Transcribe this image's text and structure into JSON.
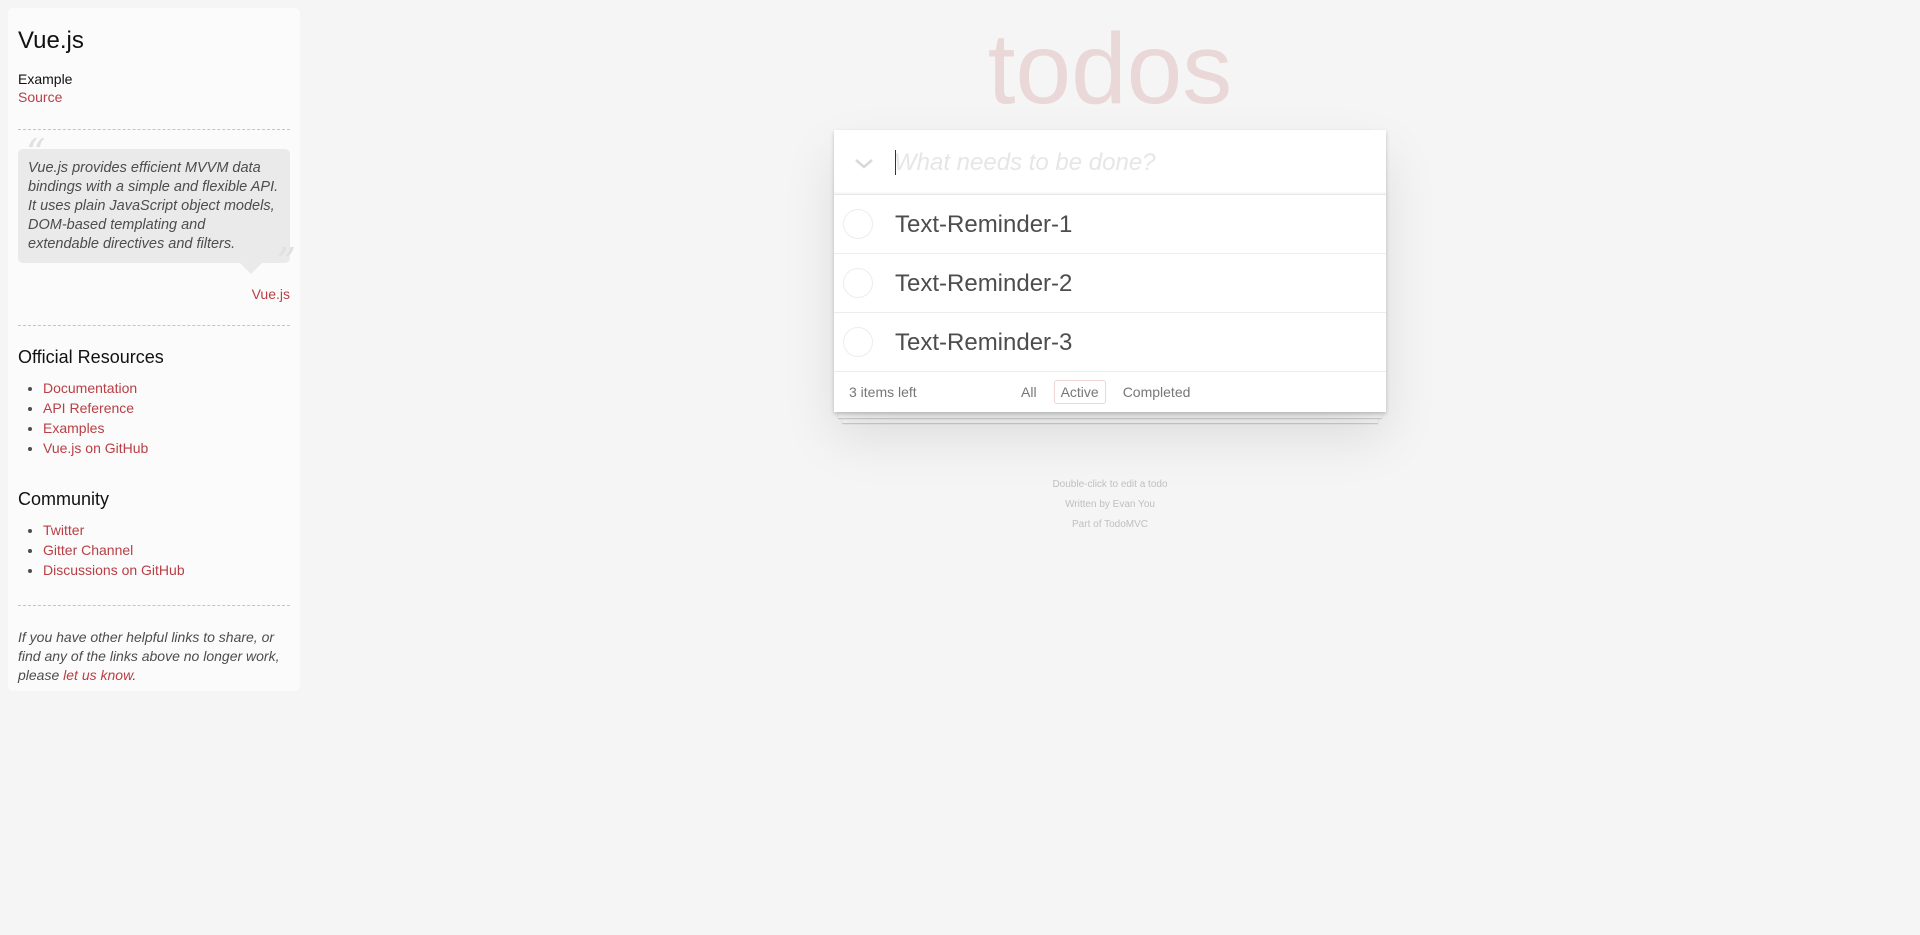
{
  "sidebar": {
    "title": "Vue.js",
    "example_label": "Example",
    "source_link": "Source",
    "quote": {
      "text": "Vue.js provides efficient MVVM data bindings with a simple and flexible API. It uses plain JavaScript object models, DOM-based templating and extendable directives and filters.",
      "footer": "Vue.js"
    },
    "official_resources": {
      "title": "Official Resources",
      "links": [
        "Documentation",
        "API Reference",
        "Examples",
        "Vue.js on GitHub"
      ]
    },
    "community": {
      "title": "Community",
      "links": [
        "Twitter",
        "Gitter Channel",
        "Discussions on GitHub"
      ]
    },
    "note": {
      "prefix": "If you have other helpful links to share, or find any of the links above no longer work, please ",
      "link": "let us know",
      "suffix": "."
    }
  },
  "app": {
    "title": "todos",
    "new_todo_placeholder": "What needs to be done?",
    "new_todo_value": "",
    "toggle_all_icon": "chevron-down-icon",
    "todos": [
      {
        "title": "Text-Reminder-1",
        "completed": false
      },
      {
        "title": "Text-Reminder-2",
        "completed": false
      },
      {
        "title": "Text-Reminder-3",
        "completed": false
      }
    ],
    "footer": {
      "count_text": "3 items left",
      "filters": [
        "All",
        "Active",
        "Completed"
      ],
      "selected_filter": "Active"
    }
  },
  "info": {
    "line1": "Double-click to edit a todo",
    "line2": "Written by Evan You",
    "line3": "Part of TodoMVC"
  },
  "colors": {
    "background": "#f5f5f5",
    "accent": "#b83f45",
    "title": "rgba(175, 47, 47, 0.15)"
  }
}
